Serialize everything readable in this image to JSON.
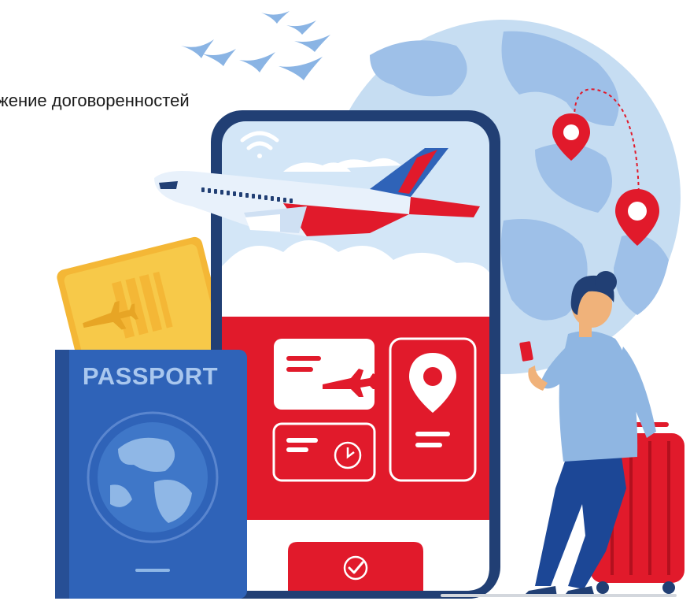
{
  "caption_text": "жение договоренностей",
  "passport_label": "PASSPORT",
  "colors": {
    "globe_light": "#c6ddf2",
    "globe_land": "#8fb7e6",
    "phone_frame": "#213f74",
    "phone_screen": "#d3e6f7",
    "brand_red": "#e11a2b",
    "passport_blue": "#2f63b8",
    "ticket_yellow": "#f6c23c",
    "sweater": "#8fb6e2",
    "trousers": "#1c4796"
  },
  "icons": [
    "wifi-icon",
    "airplane-icon",
    "ticket-icon",
    "location-pin-icon",
    "clock-icon",
    "check-icon",
    "globe-icon",
    "bird-icon"
  ]
}
